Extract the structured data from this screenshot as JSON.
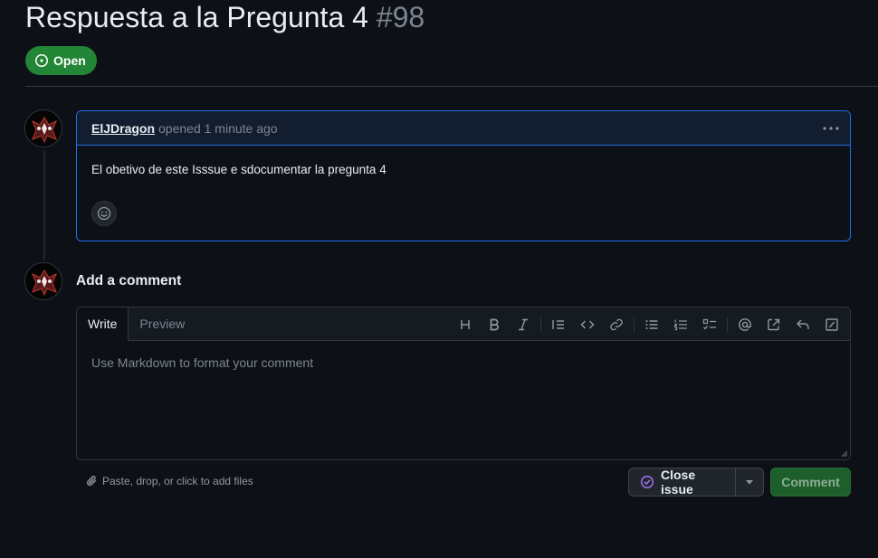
{
  "issue": {
    "title": "Respuesta a la Pregunta 4",
    "number": "#98",
    "state_label": "Open"
  },
  "comment": {
    "author": "ElJDragon",
    "meta": "opened 1 minute ago",
    "body": "El obetivo de este Isssue e sdocumentar la pregunta 4"
  },
  "new_comment": {
    "heading": "Add a comment",
    "tabs": [
      "Write",
      "Preview"
    ],
    "placeholder": "Use Markdown to format your comment",
    "attach_text": "Paste, drop, or click to add files"
  },
  "toolbar_icons": [
    "heading-icon",
    "bold-icon",
    "italic-icon",
    "quote-icon",
    "code-icon",
    "link-icon",
    "bulleted-list-icon",
    "numbered-list-icon",
    "task-list-icon",
    "mention-icon",
    "cross-reference-icon",
    "saved-replies-icon",
    "slash-commands-icon"
  ],
  "actions": {
    "close_label": "Close issue",
    "comment_label": "Comment"
  },
  "colors": {
    "background": "#0d1117",
    "open_green": "#238636",
    "comment_border": "#1f6feb",
    "close_icon_purple": "#a371f7"
  }
}
